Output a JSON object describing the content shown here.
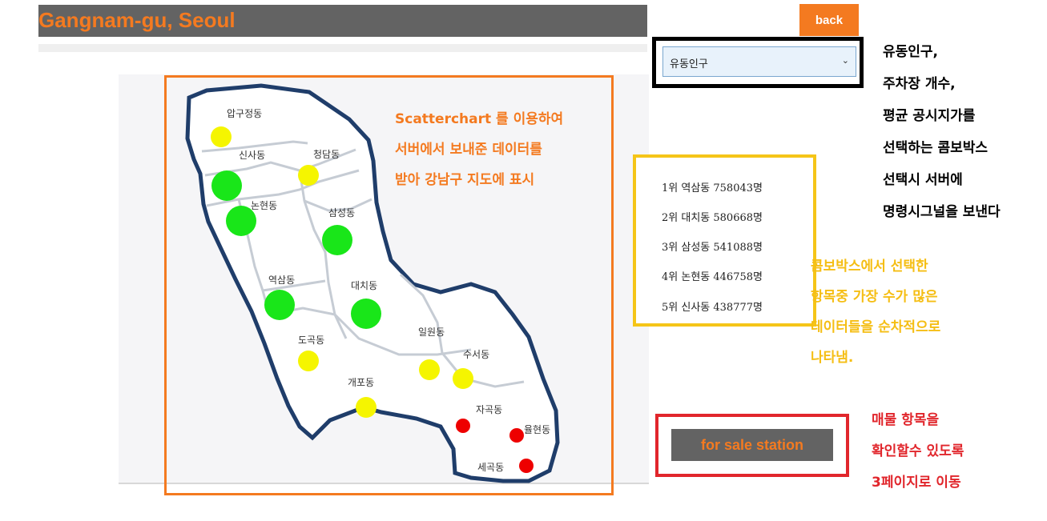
{
  "header": {
    "title": "Gangnam-gu, Seoul",
    "back_label": "back"
  },
  "combo": {
    "selected": "유동인구"
  },
  "annotations": {
    "combo_note": [
      "유동인구,",
      "주차장 개수,",
      "평균 공시지가를",
      "선택하는 콤보박스",
      "선택시 서버에",
      "명령시그널을 보낸다"
    ],
    "map_note": [
      "Scatterchart 를 이용하여",
      "서버에서 보내준 데이터를",
      "받아 강남구 지도에 표시"
    ],
    "rank_note": [
      "콤보박스에서 선택한",
      "항목중 가장 수가 많은",
      "데이터들을 순차적으로",
      "나타냄."
    ],
    "sale_note": [
      "매물 항목을",
      "확인할수 있도록",
      "3페이지로 이동"
    ]
  },
  "ranking": [
    {
      "text": "1위  역삼동 758043명"
    },
    {
      "text": "2위  대치동 580668명"
    },
    {
      "text": "3위  삼성동 541088명"
    },
    {
      "text": "4위  논현동 446758명"
    },
    {
      "text": "5위  신사동 438777명"
    }
  ],
  "sale_button": {
    "label": "for sale station"
  },
  "map": {
    "district_labels": [
      "압구정동",
      "신사동",
      "청담동",
      "논현동",
      "삼성동",
      "역삼동",
      "대치동",
      "도곡동",
      "일원동",
      "수서동",
      "개포동",
      "자곡동",
      "율현동",
      "세곡동"
    ],
    "point_colors": {
      "high": "#19e619",
      "medium": "#f5f500",
      "low": "#ee0000"
    },
    "points": [
      {
        "district": "압구정동",
        "level": "medium"
      },
      {
        "district": "신사동",
        "level": "high"
      },
      {
        "district": "청담동",
        "level": "medium"
      },
      {
        "district": "논현동",
        "level": "high"
      },
      {
        "district": "삼성동",
        "level": "high"
      },
      {
        "district": "역삼동",
        "level": "high"
      },
      {
        "district": "대치동",
        "level": "high"
      },
      {
        "district": "도곡동",
        "level": "medium"
      },
      {
        "district": "일원동",
        "level": "medium"
      },
      {
        "district": "수서동",
        "level": "medium"
      },
      {
        "district": "개포동",
        "level": "medium"
      },
      {
        "district": "자곡동",
        "level": "low"
      },
      {
        "district": "율현동",
        "level": "low"
      },
      {
        "district": "세곡동",
        "level": "low"
      }
    ]
  }
}
